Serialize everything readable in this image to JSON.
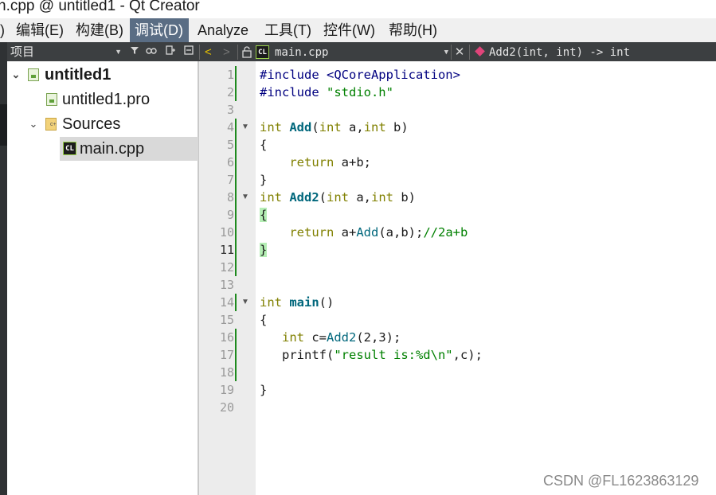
{
  "window": {
    "title": "n.cpp @ untitled1 - Qt Creator"
  },
  "menu": [
    {
      "label": ")",
      "active": false
    },
    {
      "label": "编辑(E)",
      "active": false
    },
    {
      "label": "构建(B)",
      "active": false
    },
    {
      "label": "调试(D)",
      "active": true
    },
    {
      "label": "Analyze",
      "active": false
    },
    {
      "label": "工具(T)",
      "active": false
    },
    {
      "label": "控件(W)",
      "active": false
    },
    {
      "label": "帮助(H)",
      "active": false
    }
  ],
  "project_panel": {
    "combo_label": "项目",
    "tree": [
      {
        "label": "untitled1",
        "icon": "project-icon",
        "expanded": true,
        "bold": true
      },
      {
        "label": "untitled1.pro",
        "icon": "pro-file-icon"
      },
      {
        "label": "Sources",
        "icon": "sources-folder-icon",
        "expanded": true
      },
      {
        "label": "main.cpp",
        "icon": "cpp-file-icon",
        "selected": true
      }
    ]
  },
  "editor_toolbar": {
    "file_name": "main.cpp",
    "symbol": "Add2(int, int) -> int"
  },
  "editor": {
    "current_line": 11,
    "lines": [
      {
        "n": "1",
        "text": "#include <QCoreApplication>"
      },
      {
        "n": "2",
        "text": "#include \"stdio.h\""
      },
      {
        "n": "3",
        "text": ""
      },
      {
        "n": "4",
        "text": "int Add(int a,int b)"
      },
      {
        "n": "5",
        "text": "{"
      },
      {
        "n": "6",
        "text": "    return a+b;"
      },
      {
        "n": "7",
        "text": "}"
      },
      {
        "n": "8",
        "text": "int Add2(int a,int b)"
      },
      {
        "n": "9",
        "text": "{"
      },
      {
        "n": "10",
        "text": "    return a+Add(a,b);//2a+b"
      },
      {
        "n": "11",
        "text": "}"
      },
      {
        "n": "12",
        "text": ""
      },
      {
        "n": "13",
        "text": ""
      },
      {
        "n": "14",
        "text": "int main()"
      },
      {
        "n": "15",
        "text": "{"
      },
      {
        "n": "16",
        "text": "   int c=Add2(2,3);"
      },
      {
        "n": "17",
        "text": "   printf(\"result is:%d\\n\",c);"
      },
      {
        "n": "18",
        "text": ""
      },
      {
        "n": "19",
        "text": "}"
      },
      {
        "n": "20",
        "text": ""
      }
    ]
  },
  "watermark": "CSDN @FL1623863129",
  "colors": {
    "menu_active": "#5a6d84",
    "toolbar_bg": "#3c3f41",
    "change_marker": "#1e8a1e",
    "keyword": "#808000",
    "function": "#00677c",
    "string": "#008000",
    "brace_match": "#b4eeb4"
  }
}
